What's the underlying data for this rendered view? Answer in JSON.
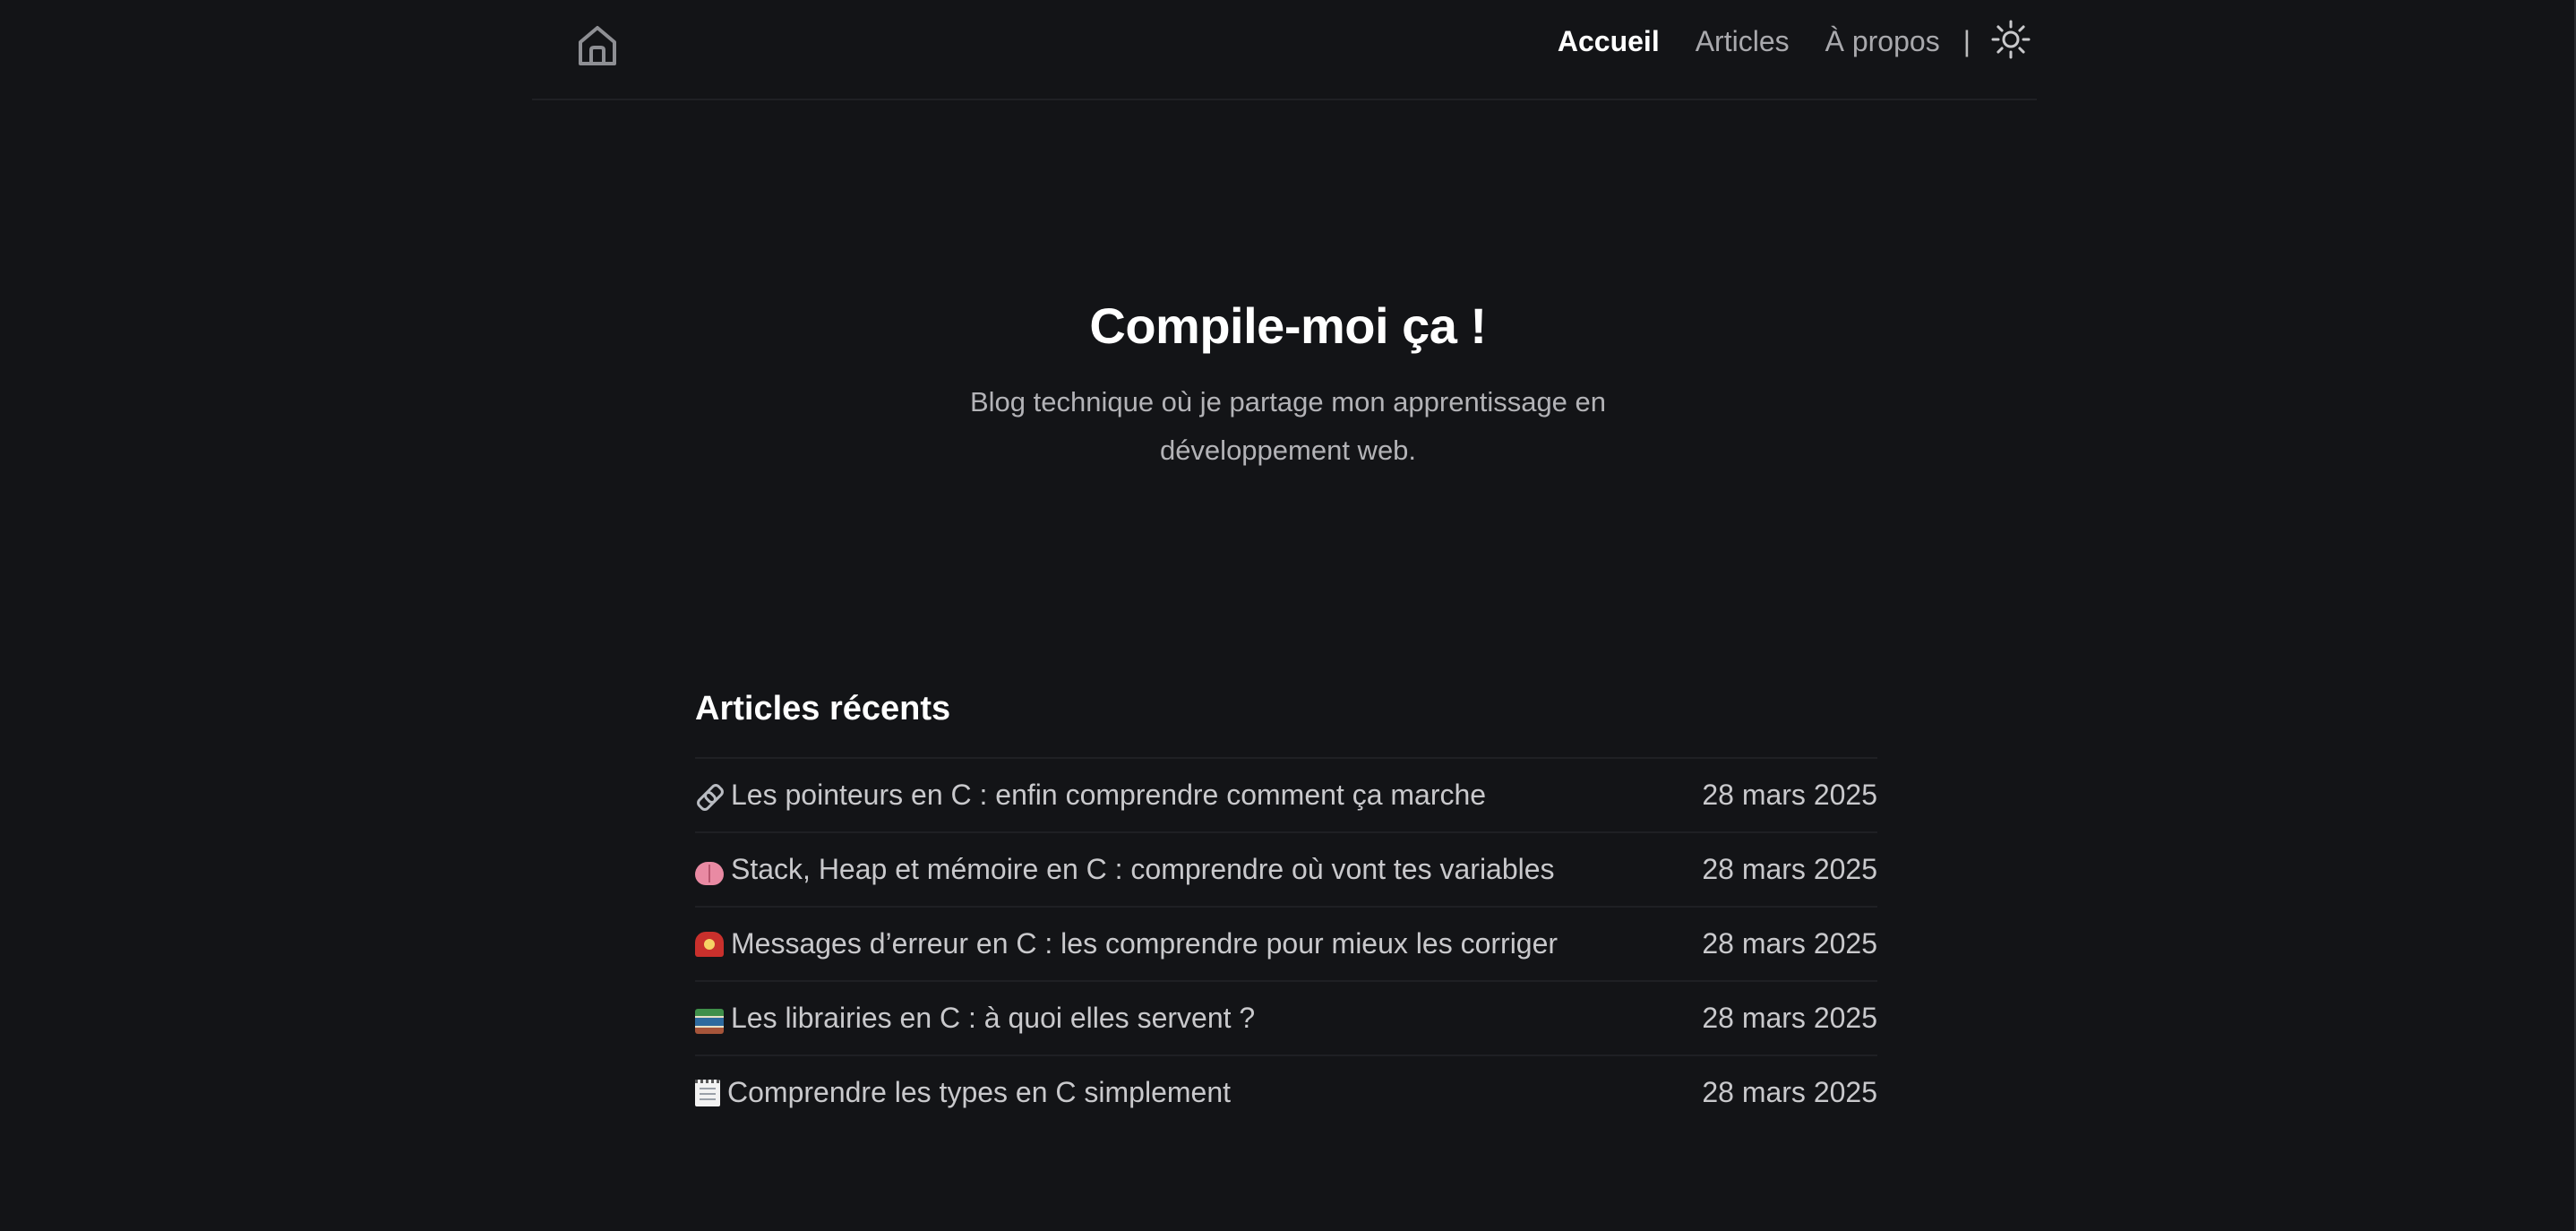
{
  "header": {
    "home_icon": "home-icon",
    "nav": [
      {
        "label": "Accueil",
        "active": true
      },
      {
        "label": "Articles",
        "active": false
      },
      {
        "label": "À propos",
        "active": false
      }
    ],
    "separator": "|",
    "theme_icon": "sun-icon"
  },
  "hero": {
    "title": "Compile-moi ça !",
    "subtitle": "Blog technique où je partage mon apprentissage en développement web."
  },
  "recent": {
    "heading": "Articles récents",
    "articles": [
      {
        "icon": "link-emoji-icon",
        "title": "Les pointeurs en C : enfin comprendre comment ça marche",
        "date": "28 mars 2025"
      },
      {
        "icon": "brain-emoji-icon",
        "title": "Stack, Heap et mémoire en C : comprendre où vont tes variables",
        "date": "28 mars 2025"
      },
      {
        "icon": "siren-emoji-icon",
        "title": "Messages d’erreur en C : les comprendre pour mieux les corriger",
        "date": "28 mars 2025"
      },
      {
        "icon": "books-emoji-icon",
        "title": "Les librairies en C : à quoi elles servent ?",
        "date": "28 mars 2025"
      },
      {
        "icon": "notepad-emoji-icon",
        "title": "Comprendre les types en C simplement",
        "date": "28 mars 2025"
      }
    ]
  },
  "colors": {
    "background": "#131417",
    "text_primary": "#ffffff",
    "text_secondary": "#b3b3b7",
    "divider": "#1f2024"
  }
}
